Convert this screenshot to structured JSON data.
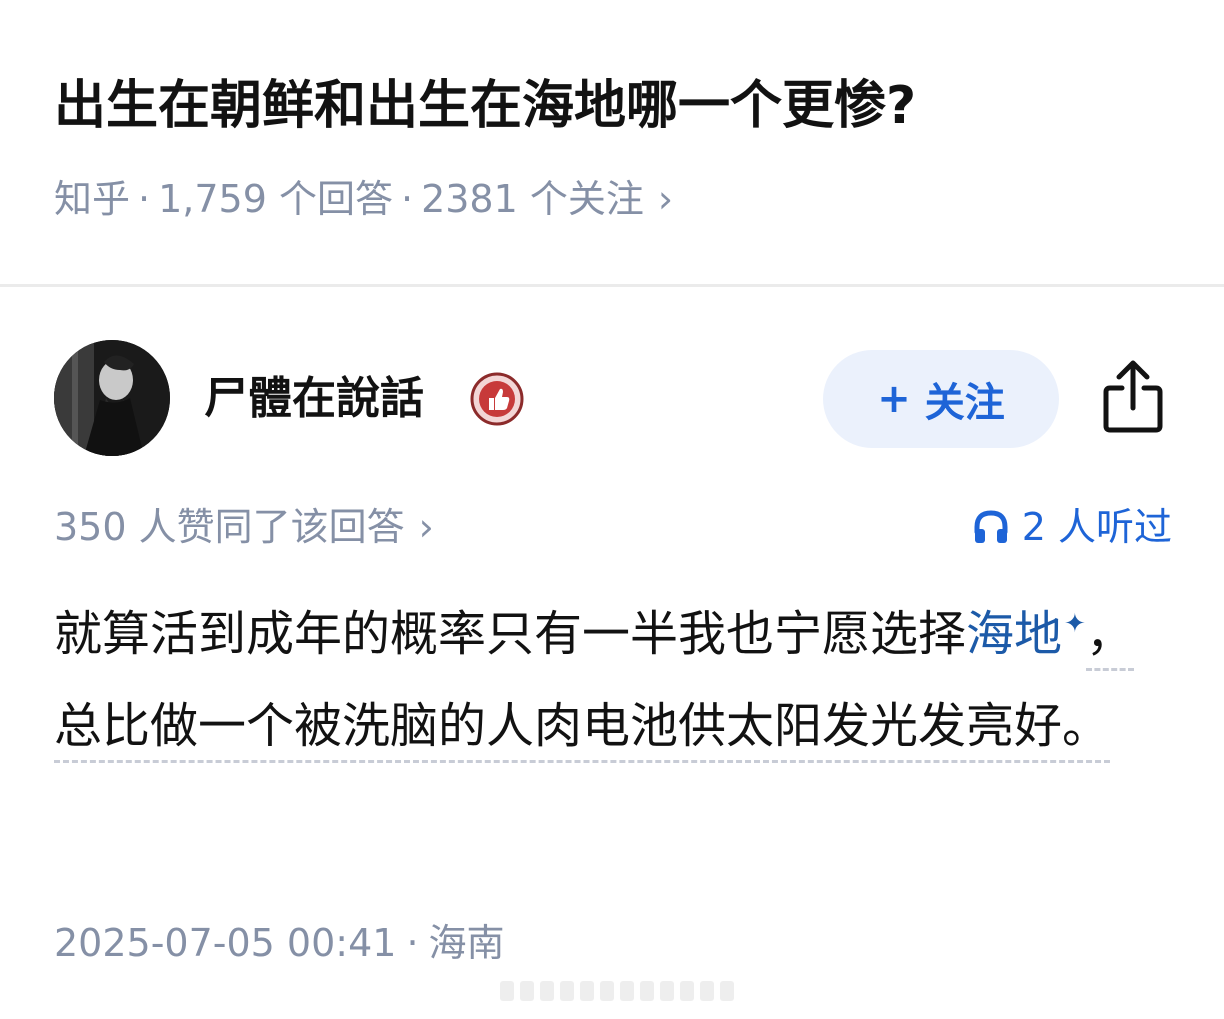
{
  "question": {
    "title": "出生在朝鲜和出生在海地哪一个更惨?",
    "source": "知乎",
    "answers_count": "1,759 个回答",
    "followers_count": "2381 个关注",
    "chevron": "›"
  },
  "author": {
    "name": "尸體在說話",
    "avatar_icon": "avatar-photo",
    "badge_icon": "thumbs-up-badge-icon",
    "follow_label": "关注",
    "follow_plus": "+",
    "share_icon": "share-icon"
  },
  "stats": {
    "votes": "350 人赞同了该回答",
    "chevron": "›",
    "listened": "2 人听过",
    "listen_icon": "headphones-icon"
  },
  "answer": {
    "part1": "就算活到成年的概率只有一半我也宁愿选择",
    "link_text": "海地",
    "link_mark": "✦",
    "part2": "，总比做一个被洗脑的人肉电池供太阳发光发亮好。"
  },
  "footer": {
    "timestamp": "2025-07-05 00:41",
    "location": "海南"
  },
  "colors": {
    "accent": "#1e64d7",
    "meta_gray": "#8590a6",
    "link_blue": "#1c5aa8"
  }
}
